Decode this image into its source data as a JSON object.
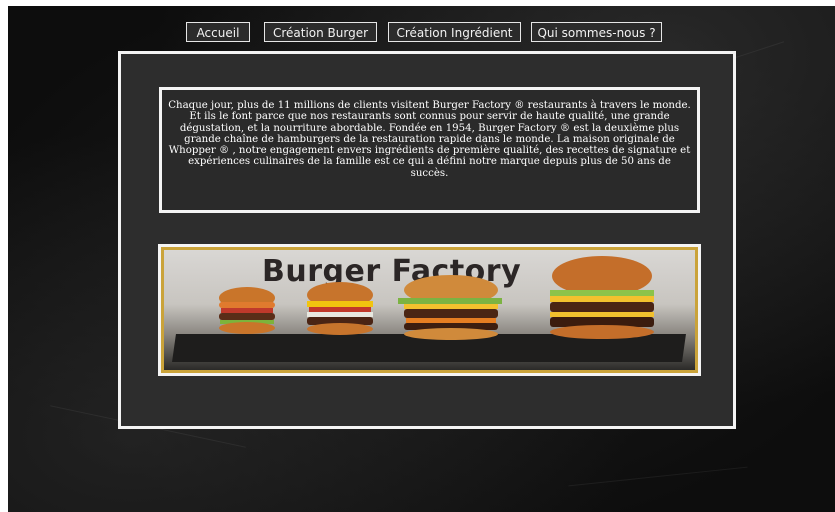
{
  "nav": {
    "items": [
      {
        "label": "Accueil"
      },
      {
        "label": "Création Burger"
      },
      {
        "label": "Création Ingrédient"
      },
      {
        "label": "Qui sommes-nous ?"
      }
    ]
  },
  "about": {
    "text": "Chaque jour, plus de 11 millions de clients visitent Burger Factory ® restaurants à travers le monde. Et ils le font parce que nos restaurants sont connus pour servir de haute qualité, une grande dégustation, et la nourriture abordable. Fondée en 1954, Burger Factory ® est la deuxième plus grande chaîne de hamburgers de la restauration rapide dans le monde. La maison originale de Whopper ® , notre engagement envers ingrédients de première qualité, des recettes de signature et expériences culinaires de la famille est ce qui a défini notre marque depuis plus de 50 ans de succès."
  },
  "banner": {
    "title": "Burger Factory"
  },
  "colors": {
    "background": "#151515",
    "panel": "#2d2d2d",
    "border": "#f4f4f4",
    "banner_frame": "#caa33a"
  }
}
